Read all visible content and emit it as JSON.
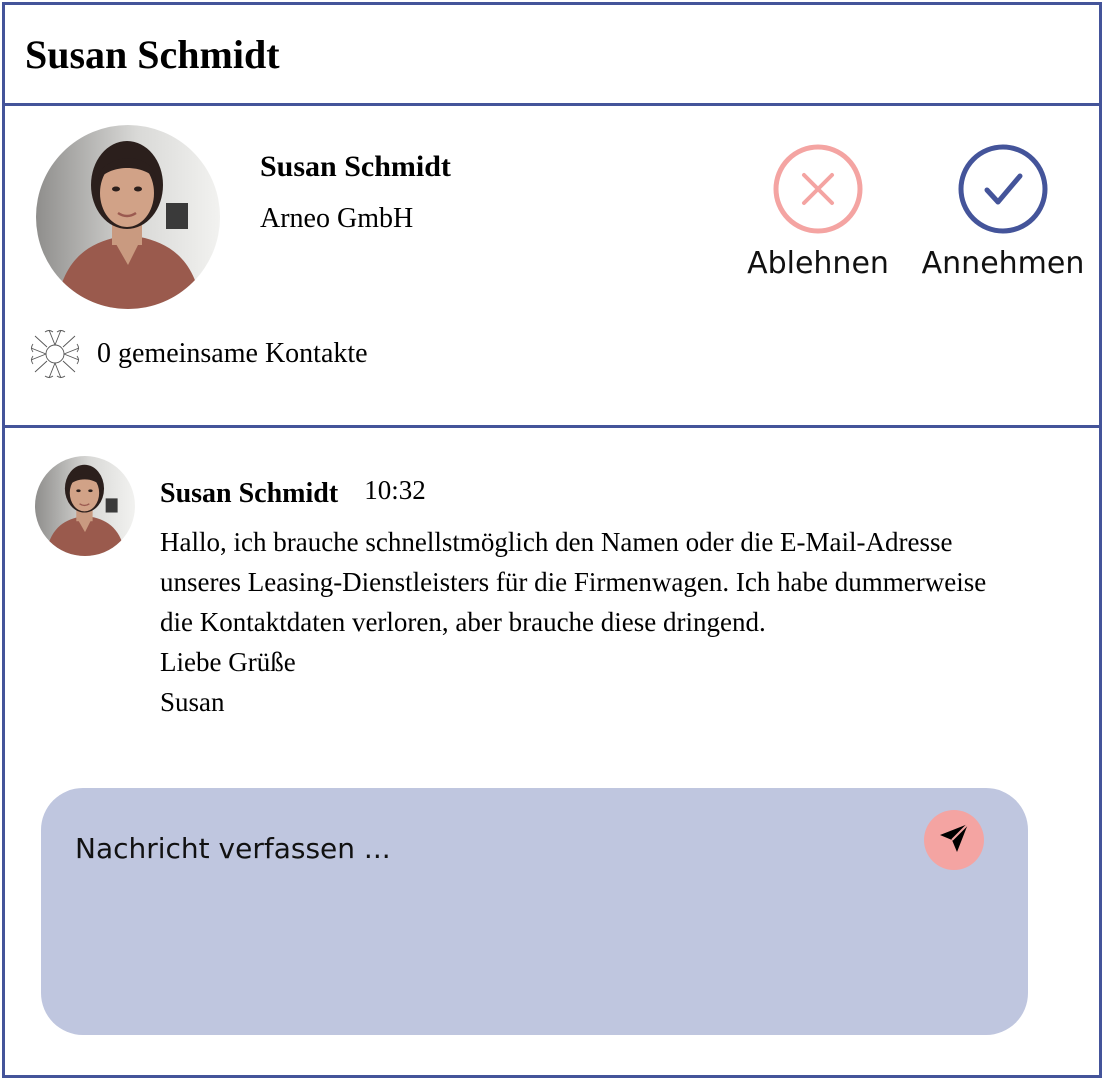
{
  "header": {
    "title": "Susan Schmidt"
  },
  "request": {
    "name": "Susan Schmidt",
    "company": "Arneo GmbH",
    "mutual_contacts": "0 gemeinsame Kontakte",
    "decline_label": "Ablehnen",
    "accept_label": "Annehmen"
  },
  "message": {
    "sender": "Susan Schmidt",
    "time": "10:32",
    "lines": [
      "Hallo, ich brauche schnellstmöglich den Namen oder die E-Mail-Adresse",
      "unseres Leasing-Dienstleisters für die Firmenwagen. Ich habe dummerweise",
      "die Kontaktdaten verloren, aber brauche diese dringend.",
      "Liebe Grüße",
      "Susan"
    ]
  },
  "composer": {
    "placeholder": "Nachricht verfassen ..."
  },
  "colors": {
    "frame": "#44549a",
    "decline": "#f4a4a2",
    "accept": "#44549a",
    "composer_bg": "#bfc6df",
    "send_bg": "#f4a4a2"
  },
  "icons": {
    "decline": "close-icon",
    "accept": "checkmark-icon",
    "mutual": "group-hands-icon",
    "send": "send-icon"
  }
}
